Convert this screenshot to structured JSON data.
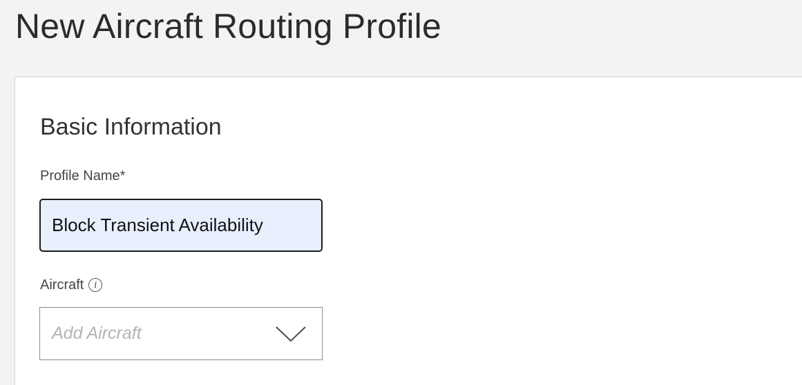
{
  "page": {
    "title": "New Aircraft Routing Profile"
  },
  "section": {
    "title": "Basic Information"
  },
  "fields": {
    "profile_name": {
      "label": "Profile Name*",
      "value": "Block Transient Availability"
    },
    "aircraft": {
      "label": "Aircraft",
      "info_icon_glyph": "i",
      "placeholder": "Add Aircraft",
      "icon": "chevron-down-icon"
    }
  },
  "colors": {
    "page_background": "#f3f3f3",
    "card_background": "#ffffff",
    "input_fill": "#e8f0fe",
    "input_border": "#1a1a1a",
    "placeholder_text": "#b4b4b4"
  }
}
